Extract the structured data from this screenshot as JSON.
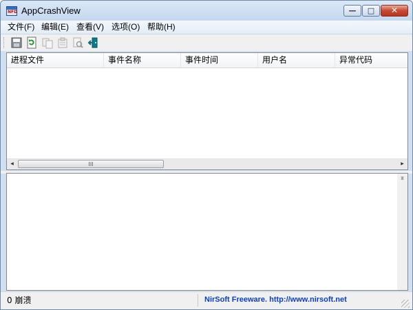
{
  "window": {
    "title": "AppCrashView",
    "icon_text": "NFD",
    "minimize_glyph": "—",
    "maximize_glyph": "□",
    "close_glyph": "✕"
  },
  "menu": [
    "文件(F)",
    "编辑(E)",
    "查看(V)",
    "选项(O)",
    "帮助(H)"
  ],
  "toolbar": {
    "buttons": [
      "save-icon",
      "refresh-icon",
      "copy-icon",
      "properties-icon",
      "find-icon",
      "exit-icon"
    ]
  },
  "table": {
    "columns": [
      "进程文件",
      "事件名称",
      "事件时间",
      "用户名",
      "异常代码"
    ],
    "sort_indicator": "/",
    "rows": []
  },
  "scroll": {
    "left": "◂",
    "right": "▸",
    "up": "▴",
    "down": "▾",
    "grip": "III"
  },
  "status": {
    "count_text": "0 崩溃",
    "link_text": "NirSoft Freeware.  http://www.nirsoft.net"
  }
}
